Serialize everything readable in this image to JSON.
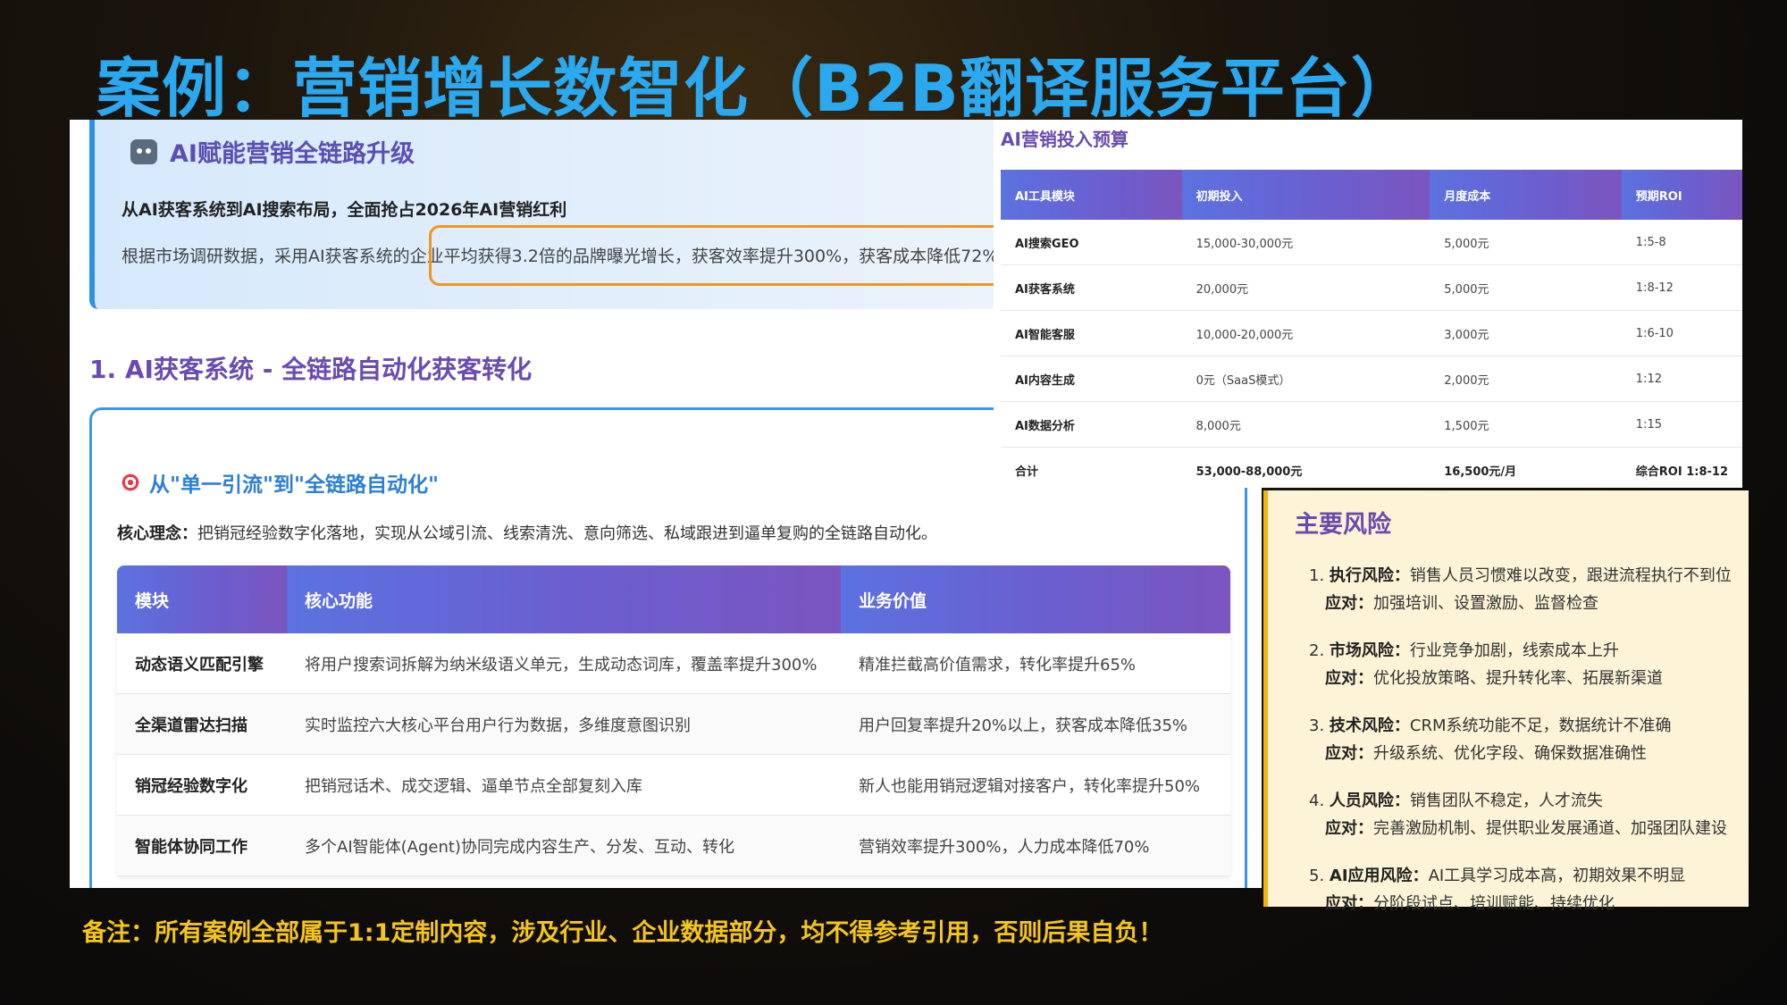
{
  "title": "案例：营销增长数智化（B2B翻译服务平台）",
  "ai_card": {
    "title": "AI赋能营销全链路升级",
    "subtitle": "从AI获客系统到AI搜索布局，全面抢占2026年AI营销红利",
    "text": "根据市场调研数据，采用AI获客系统的企业平均获得3.2倍的品牌曝光增长，获客效率提升300%，获客成本降低72%。"
  },
  "section1_title": "1. AI获客系统 - 全链路自动化获客转化",
  "inner": {
    "heading": "从\"单一引流\"到\"全链路自动化\"",
    "concept_label": "核心理念：",
    "concept_text": "把销冠经验数字化落地，实现从公域引流、线索清洗、意向筛选、私域跟进到逼单复购的全链路自动化。"
  },
  "module_table": {
    "headers": [
      "模块",
      "核心功能",
      "业务价值"
    ],
    "rows": [
      [
        "动态语义匹配引擎",
        "将用户搜索词拆解为纳米级语义单元，生成动态词库，覆盖率提升300%",
        "精准拦截高价值需求，转化率提升65%"
      ],
      [
        "全渠道雷达扫描",
        "实时监控六大核心平台用户行为数据，多维度意图识别",
        "用户回复率提升20%以上，获客成本降低35%"
      ],
      [
        "销冠经验数字化",
        "把销冠话术、成交逻辑、逼单节点全部复刻入库",
        "新人也能用销冠逻辑对接客户，转化率提升50%"
      ],
      [
        "智能体协同工作",
        "多个AI智能体(Agent)协同完成内容生产、分发、互动、转化",
        "营销效率提升300%，人力成本降低70%"
      ]
    ]
  },
  "budget": {
    "title": "AI营销投入预算",
    "headers": [
      "AI工具模块",
      "初期投入",
      "月度成本",
      "预期ROI"
    ],
    "rows": [
      [
        "AI搜索GEO",
        "15,000-30,000元",
        "5,000元",
        "1:5-8"
      ],
      [
        "AI获客系统",
        "20,000元",
        "5,000元",
        "1:8-12"
      ],
      [
        "AI智能客服",
        "10,000-20,000元",
        "3,000元",
        "1:6-10"
      ],
      [
        "AI内容生成",
        "0元（SaaS模式）",
        "2,000元",
        "1:12"
      ],
      [
        "AI数据分析",
        "8,000元",
        "1,500元",
        "1:15"
      ]
    ],
    "total": [
      "合计",
      "53,000-88,000元",
      "16,500元/月",
      "综合ROI 1:8-12"
    ]
  },
  "risks": {
    "title": "主要风险",
    "items": [
      {
        "num": "1.",
        "label": "执行风险：",
        "text": "销售人员习惯难以改变，跟进流程执行不到位",
        "resp_label": "应对：",
        "resp": "加强培训、设置激励、监督检查"
      },
      {
        "num": "2.",
        "label": "市场风险：",
        "text": "行业竞争加剧，线索成本上升",
        "resp_label": "应对：",
        "resp": "优化投放策略、提升转化率、拓展新渠道"
      },
      {
        "num": "3.",
        "label": "技术风险：",
        "text": "CRM系统功能不足，数据统计不准确",
        "resp_label": "应对：",
        "resp": "升级系统、优化字段、确保数据准确性"
      },
      {
        "num": "4.",
        "label": "人员风险：",
        "text": "销售团队不稳定，人才流失",
        "resp_label": "应对：",
        "resp": "完善激励机制、提供职业发展通道、加强团队建设"
      },
      {
        "num": "5.",
        "label": "AI应用风险：",
        "text": "AI工具学习成本高，初期效果不明显",
        "resp_label": "应对：",
        "resp": "分阶段试点、培训赋能、持续优化"
      }
    ]
  },
  "footnote": "备注：所有案例全部属于1:1定制内容，涉及行业、企业数据部分，均不得参考引用，否则后果自负！"
}
